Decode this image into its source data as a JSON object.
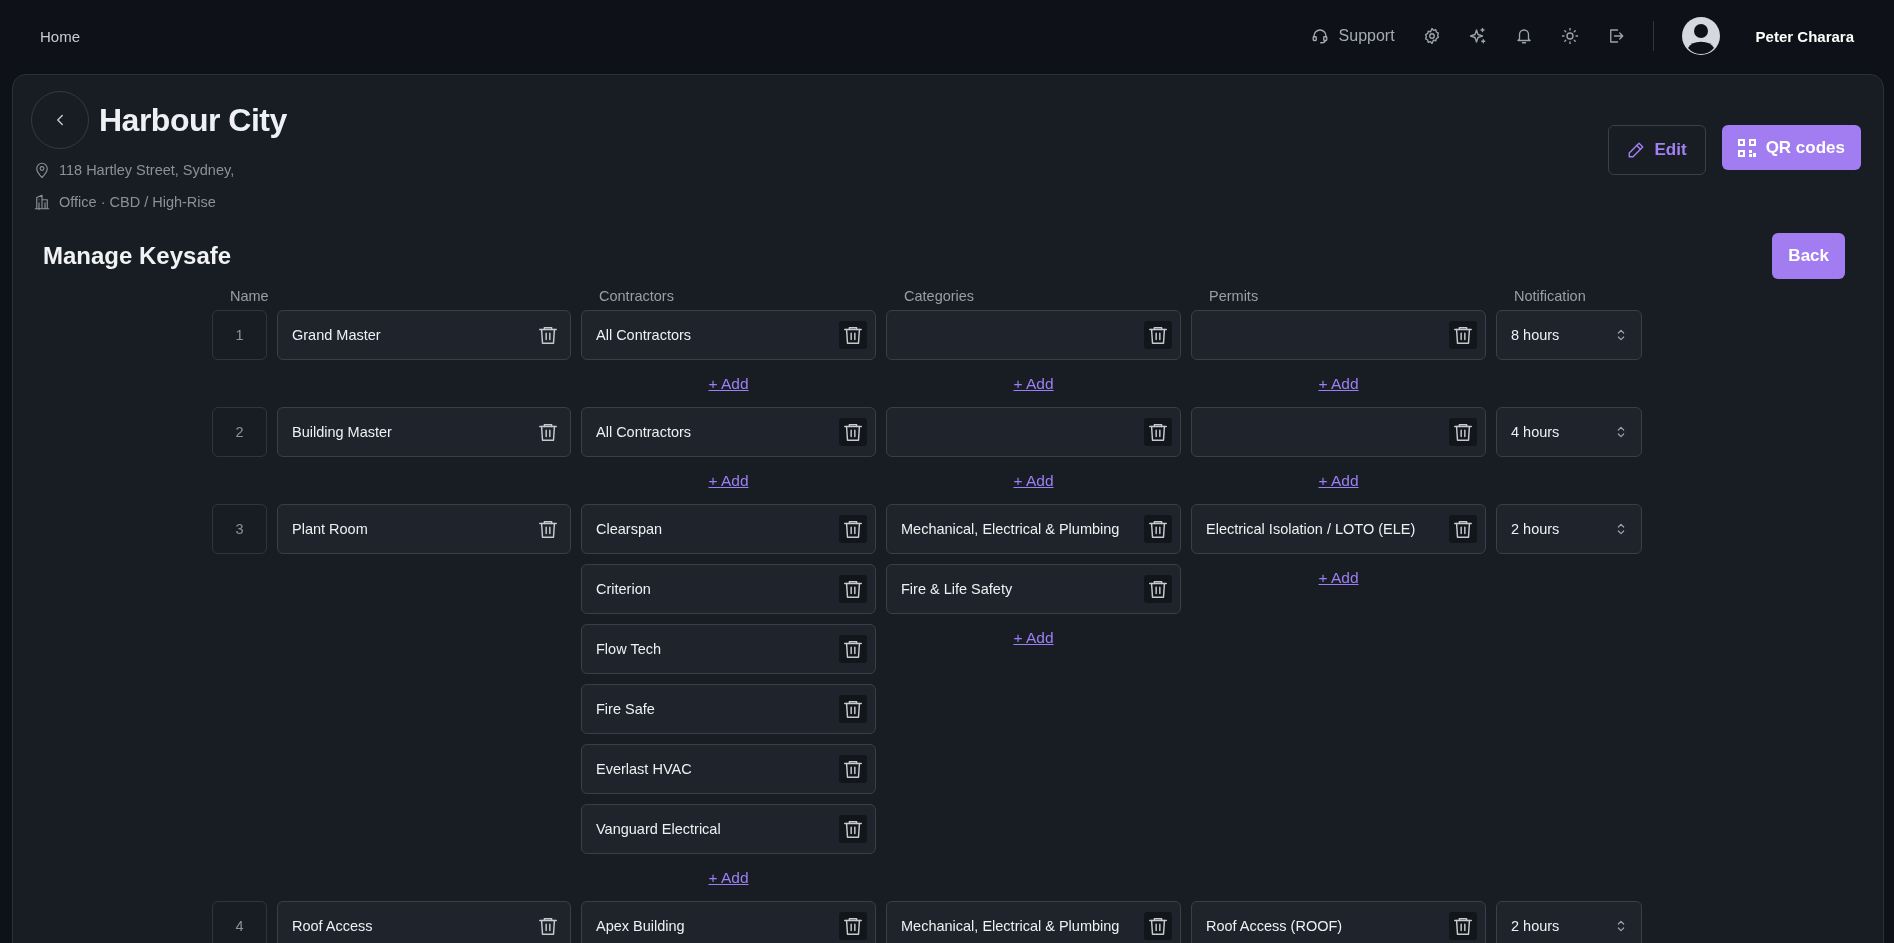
{
  "topbar": {
    "home": "Home",
    "support": "Support",
    "user_name": "Peter Charara"
  },
  "site": {
    "title": "Harbour City",
    "address": "118 Hartley Street, Sydney,",
    "type": "Office · CBD / High-Rise"
  },
  "actions": {
    "edit": "Edit",
    "qr": "QR codes"
  },
  "keysafe": {
    "title": "Manage Keysafe",
    "back": "Back",
    "columns": [
      "Name",
      "Contractors",
      "Categories",
      "Permits",
      "Notification"
    ],
    "rows": [
      {
        "index": "1",
        "name": "Grand Master",
        "lists": [
          {
            "items": [
              {
                "kind": "filled",
                "text": "All Contractors"
              }
            ],
            "add": "+ Add"
          },
          {
            "items": [
              {
                "kind": "empty"
              }
            ],
            "add": "+ Add"
          },
          {
            "items": [
              {
                "kind": "empty"
              }
            ],
            "add": "+ Add"
          }
        ],
        "notification": "8 hours"
      },
      {
        "index": "2",
        "name": "Building Master",
        "lists": [
          {
            "items": [
              {
                "kind": "filled",
                "text": "All Contractors"
              }
            ],
            "add": "+ Add"
          },
          {
            "items": [
              {
                "kind": "empty"
              }
            ],
            "add": "+ Add"
          },
          {
            "items": [
              {
                "kind": "empty"
              }
            ],
            "add": "+ Add"
          }
        ],
        "notification": "4 hours"
      },
      {
        "index": "3",
        "name": "Plant Room",
        "lists": [
          {
            "items": [
              {
                "kind": "filled",
                "text": "Clearspan"
              },
              {
                "kind": "filled",
                "text": "Criterion"
              },
              {
                "kind": "filled",
                "text": "Flow Tech"
              },
              {
                "kind": "filled",
                "text": "Fire Safe"
              },
              {
                "kind": "filled",
                "text": "Everlast HVAC"
              },
              {
                "kind": "filled",
                "text": "Vanguard Electrical"
              }
            ],
            "add": "+ Add"
          },
          {
            "items": [
              {
                "kind": "filled",
                "text": "Mechanical, Electrical & Plumbing"
              },
              {
                "kind": "filled",
                "text": "Fire & Life Safety"
              }
            ],
            "add": "+ Add"
          },
          {
            "items": [
              {
                "kind": "filled",
                "text": "Electrical Isolation / LOTO (ELE)"
              }
            ],
            "add": "+ Add"
          }
        ],
        "notification": "2 hours"
      },
      {
        "index": "4",
        "name": "Roof Access",
        "lists": [
          {
            "items": [
              {
                "kind": "filled",
                "text": "Apex Building"
              }
            ]
          },
          {
            "items": [
              {
                "kind": "filled",
                "text": "Mechanical, Electrical & Plumbing"
              }
            ]
          },
          {
            "items": [
              {
                "kind": "filled",
                "text": "Roof Access (ROOF)"
              }
            ]
          }
        ],
        "notification": "2 hours"
      }
    ]
  }
}
